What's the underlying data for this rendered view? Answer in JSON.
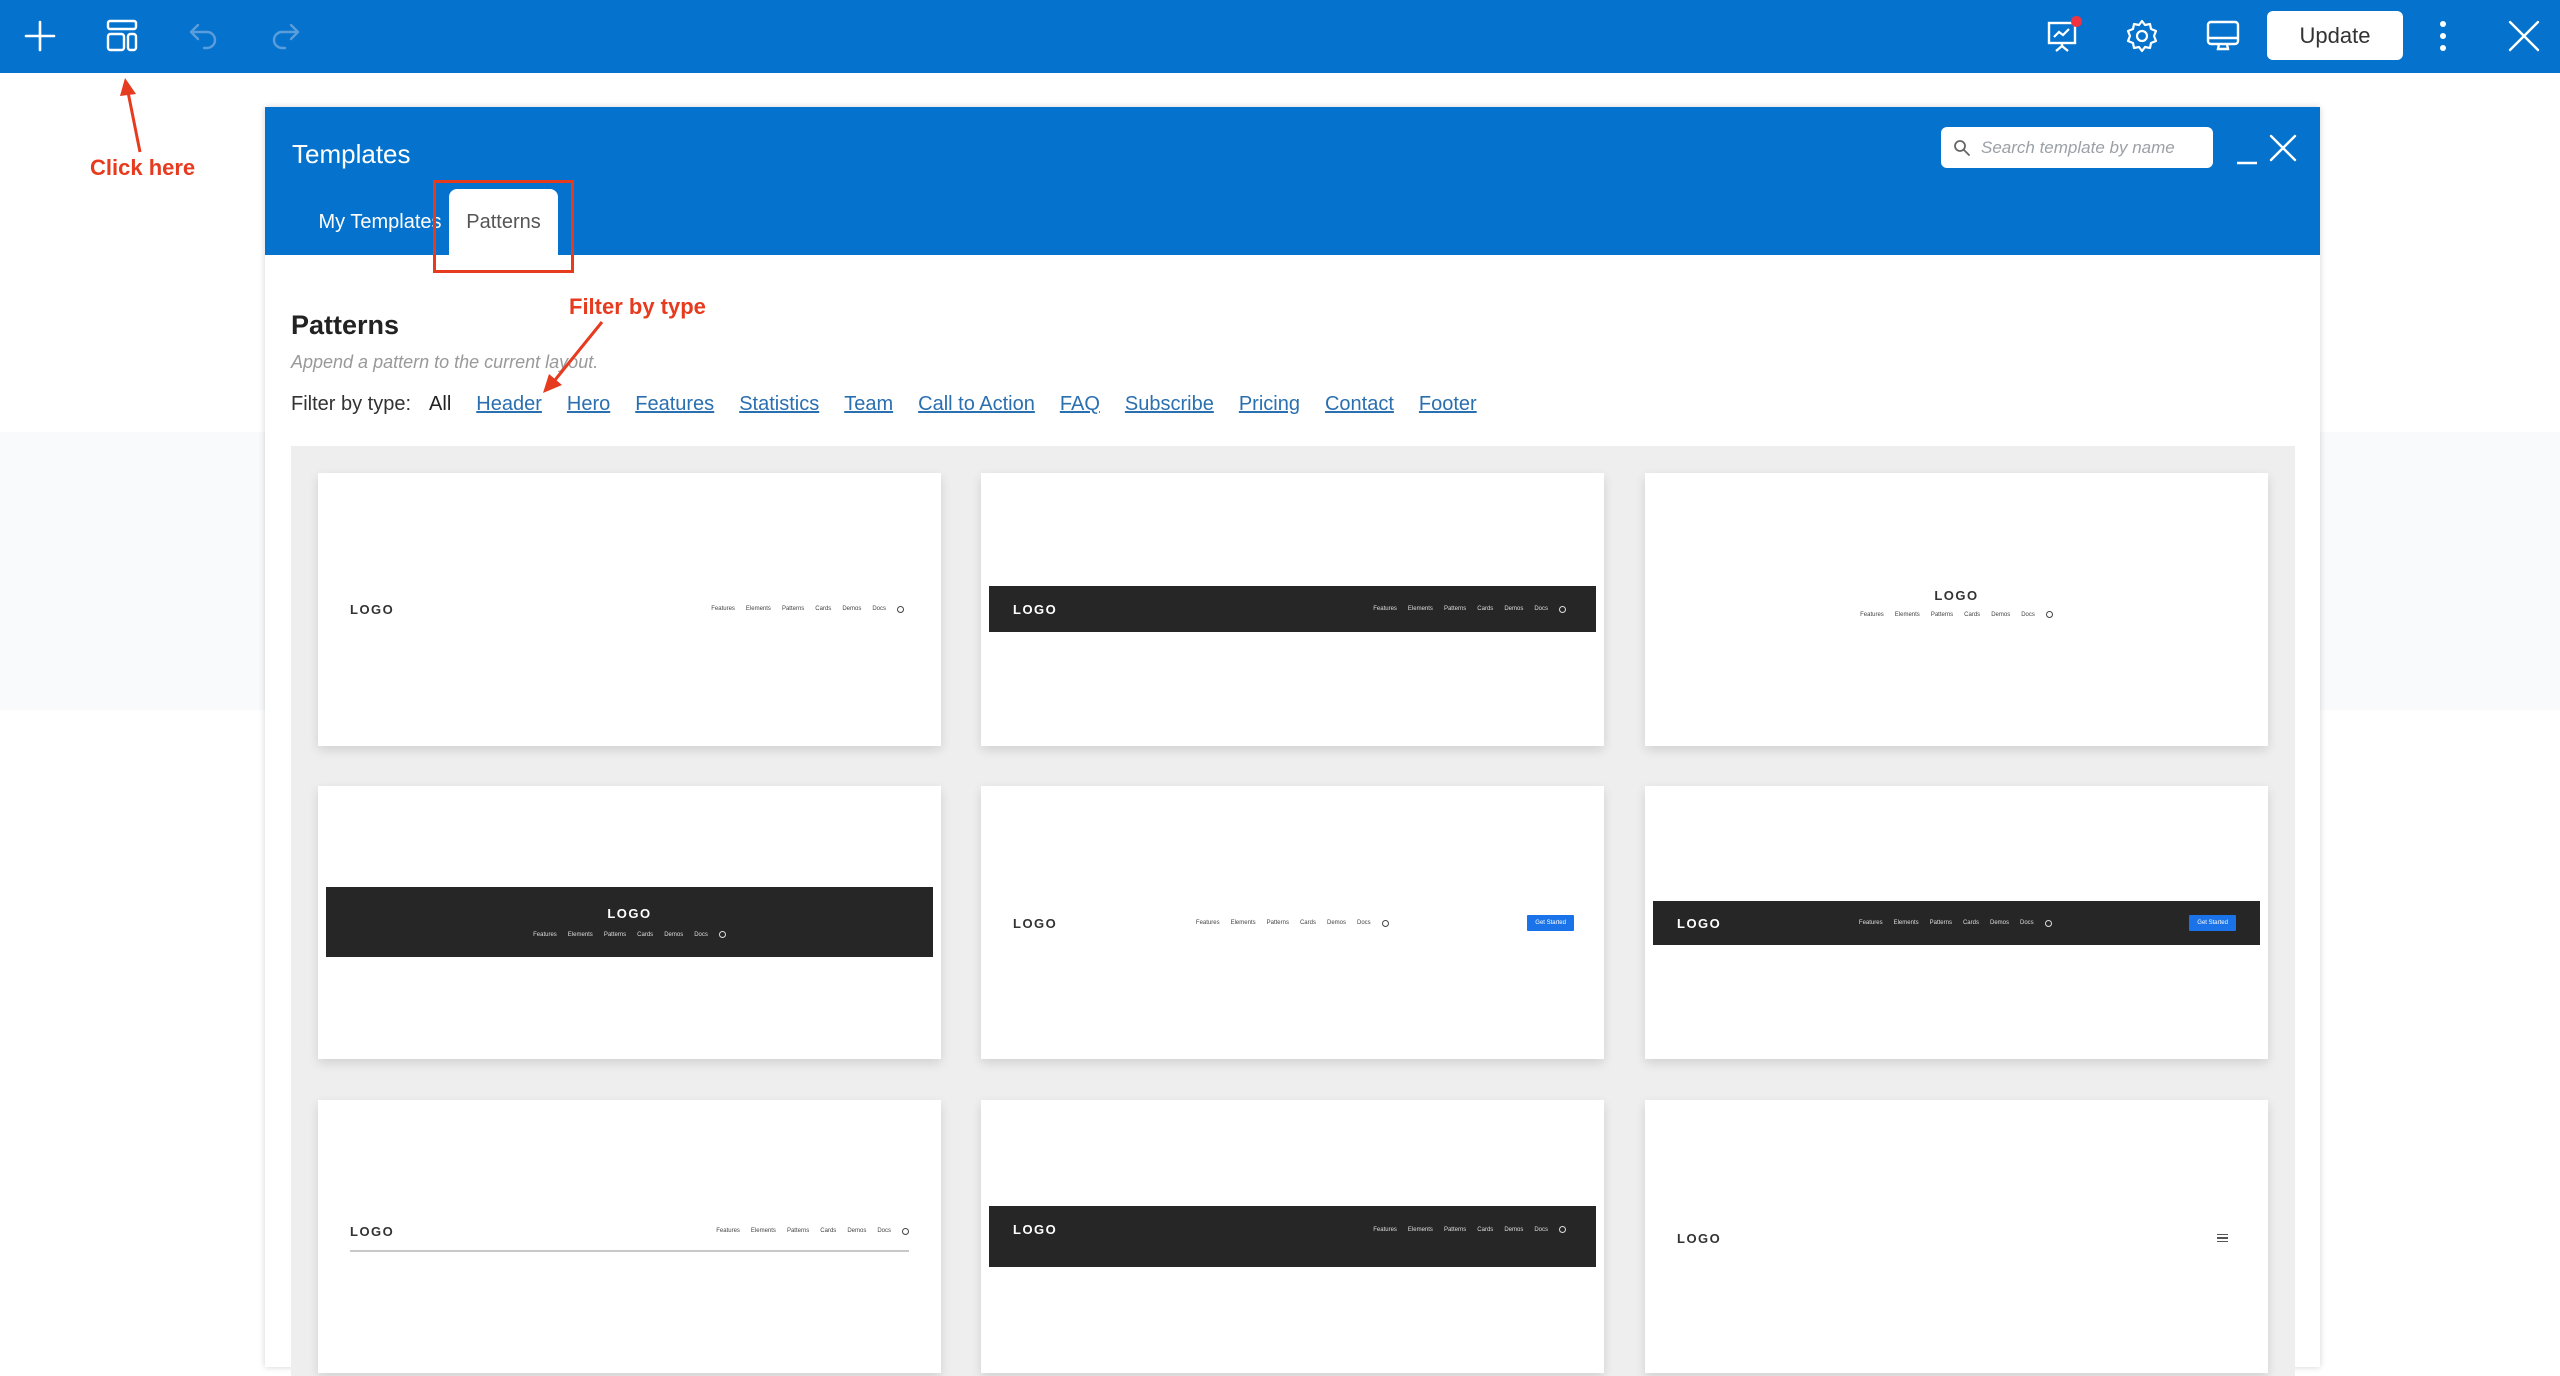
{
  "toolbar": {
    "left_icons": [
      "plus-icon",
      "layout-icon",
      "undo-icon",
      "redo-icon"
    ],
    "right_icons": [
      "presentation-chart-icon",
      "gear-icon",
      "desktop-icon"
    ],
    "update_label": "Update",
    "more_icon": "more-vertical-icon",
    "close_icon": "close-icon",
    "notification_dot_color": "#ef3340"
  },
  "annotations": {
    "click_here": "Click here",
    "filter_by_type": "Filter by type",
    "color": "#e63b1e"
  },
  "modal": {
    "title": "Templates",
    "tabs": [
      {
        "label": "My Templates",
        "active": false
      },
      {
        "label": "Patterns",
        "active": true
      }
    ],
    "search_placeholder": "Search template by name",
    "search_value": "",
    "section_title": "Patterns",
    "section_subtitle": "Append a pattern to the current layout.",
    "filter_label": "Filter by type:",
    "filters": [
      {
        "label": "All",
        "active": true
      },
      {
        "label": "Header",
        "active": false
      },
      {
        "label": "Hero",
        "active": false
      },
      {
        "label": "Features",
        "active": false
      },
      {
        "label": "Statistics",
        "active": false
      },
      {
        "label": "Team",
        "active": false
      },
      {
        "label": "Call to Action",
        "active": false
      },
      {
        "label": "FAQ",
        "active": false
      },
      {
        "label": "Subscribe",
        "active": false
      },
      {
        "label": "Pricing",
        "active": false
      },
      {
        "label": "Contact",
        "active": false
      },
      {
        "label": "Footer",
        "active": false
      }
    ],
    "accent_color": "#0573cd"
  },
  "pattern_preview": {
    "logo": "LOGO",
    "nav": [
      "Features",
      "Elements",
      "Patterns",
      "Cards",
      "Demos",
      "Docs"
    ],
    "button": "Get Started"
  },
  "patterns": [
    {
      "variant": "light-logo-left-nav-right"
    },
    {
      "variant": "dark-logo-left-nav-right"
    },
    {
      "variant": "light-centered-stacked"
    },
    {
      "variant": "dark-centered-stacked"
    },
    {
      "variant": "light-logo-nav-center-button"
    },
    {
      "variant": "dark-logo-nav-center-button"
    },
    {
      "variant": "light-logo-left-nav-right-underline"
    },
    {
      "variant": "dark-logo-left-nav-right-tall"
    },
    {
      "variant": "light-logo-hamburger"
    }
  ]
}
